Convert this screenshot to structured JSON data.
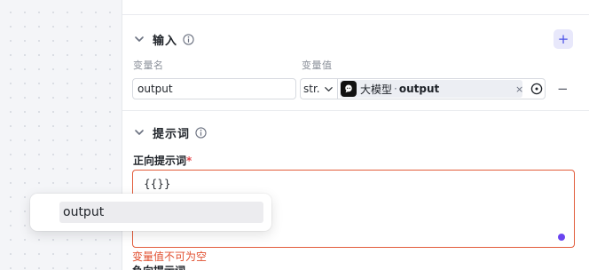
{
  "inputs_section": {
    "title": "输入",
    "add_label": "+",
    "columns": {
      "name": "变量名",
      "value": "变量值"
    },
    "row": {
      "name": "output",
      "type": "str.",
      "ref_node": "大模型",
      "ref_sep": "·",
      "ref_field": "output",
      "clear_label": "×",
      "remove_label": "−"
    }
  },
  "prompt_section": {
    "title": "提示词",
    "positive_label": "正向提示词",
    "required_mark": "*",
    "positive_value": "{{}}",
    "error": "变量值不可为空",
    "negative_label": "负向提示词"
  },
  "suggestion_popup": {
    "items": [
      "output"
    ]
  },
  "colors": {
    "accent": "#4d53e8",
    "error": "#e14f2f",
    "resize_dot": "#6a45f0"
  }
}
